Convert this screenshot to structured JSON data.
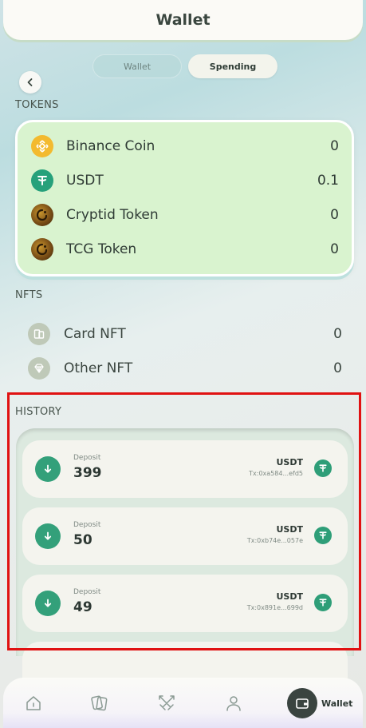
{
  "header": {
    "title": "Wallet"
  },
  "toggle": {
    "wallet_label": "Wallet",
    "spending_label": "Spending",
    "active": "Spending"
  },
  "tokens": {
    "section_label": "TOKENS",
    "items": [
      {
        "name": "Binance Coin",
        "value": "0",
        "icon": "binance-coin-icon",
        "color": "#f3ba2f"
      },
      {
        "name": "USDT",
        "value": "0.1",
        "icon": "usdt-icon",
        "color": "#26a17b"
      },
      {
        "name": "Cryptid Token",
        "value": "0",
        "icon": "cryptid-token-icon",
        "color": "#5b3a16"
      },
      {
        "name": "TCG Token",
        "value": "0",
        "icon": "tcg-token-icon",
        "color": "#5b3a16"
      }
    ]
  },
  "nfts": {
    "section_label": "NFTS",
    "items": [
      {
        "name": "Card NFT",
        "value": "0",
        "icon": "card-nft-icon"
      },
      {
        "name": "Other NFT",
        "value": "0",
        "icon": "diamond-icon"
      }
    ]
  },
  "history": {
    "section_label": "HISTORY",
    "items": [
      {
        "type": "Deposit",
        "amount": "399",
        "currency": "USDT",
        "tx": "Tx:0xa584...efd5"
      },
      {
        "type": "Deposit",
        "amount": "50",
        "currency": "USDT",
        "tx": "Tx:0xb74e...057e"
      },
      {
        "type": "Deposit",
        "amount": "49",
        "currency": "USDT",
        "tx": "Tx:0x891e...699d"
      }
    ]
  },
  "nav": {
    "items": [
      "home-icon",
      "cards-icon",
      "battle-icon",
      "profile-icon",
      "wallet-icon"
    ],
    "active_label": "Wallet"
  },
  "colors": {
    "accent_green": "#33a07a",
    "card_green": "#d9f3cf",
    "highlight_red": "#e01212"
  }
}
